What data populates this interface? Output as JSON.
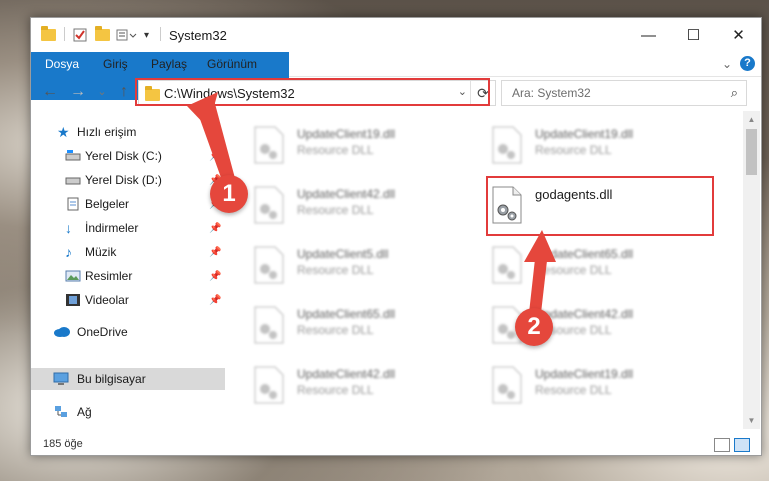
{
  "window": {
    "title": "System32",
    "minimize": "—",
    "maximize": "☐",
    "close": "✕"
  },
  "ribbon": {
    "tabs": [
      "Dosya",
      "Giriş",
      "Paylaş",
      "Görünüm"
    ],
    "collapse": "⌄",
    "help": "?"
  },
  "navigation": {
    "back": "←",
    "forward": "→",
    "recent": "⌄",
    "up": "↑",
    "address_path": "C:\\Windows\\System32",
    "address_dropdown": "⌄",
    "refresh": "⟳",
    "search_placeholder": "Ara: System32",
    "search_icon": "⌕"
  },
  "sidebar": {
    "items": [
      {
        "label": "Hızlı erişim",
        "icon": "star-icon"
      },
      {
        "label": "Yerel Disk (C:)",
        "icon": "drive-icon"
      },
      {
        "label": "Yerel Disk (D:)",
        "icon": "drive-icon"
      },
      {
        "label": "Belgeler",
        "icon": "documents-icon"
      },
      {
        "label": "İndirmeler",
        "icon": "download-icon"
      },
      {
        "label": "Müzik",
        "icon": "music-icon"
      },
      {
        "label": "Resimler",
        "icon": "pictures-icon"
      },
      {
        "label": "Videolar",
        "icon": "videos-icon"
      },
      {
        "label": "OneDrive",
        "icon": "cloud-icon"
      },
      {
        "label": "Bu bilgisayar",
        "icon": "computer-icon"
      },
      {
        "label": "Ağ",
        "icon": "network-icon"
      }
    ],
    "pin_glyph": "📌"
  },
  "files": [
    {
      "name": "UpdateClient19.dll",
      "type": "Resource DLL"
    },
    {
      "name": "UpdateClient19.dll",
      "type": "Resource DLL"
    },
    {
      "name": "UpdateClient42.dll",
      "type": "Resource DLL"
    },
    {
      "name": "godagents.dll",
      "type": ""
    },
    {
      "name": "UpdateClient5.dll",
      "type": "Resource DLL"
    },
    {
      "name": "UpdateClient65.dll",
      "type": "Resource DLL"
    },
    {
      "name": "UpdateClient65.dll",
      "type": "Resource DLL"
    },
    {
      "name": "UpdateClient42.dll",
      "type": "Resource DLL"
    },
    {
      "name": "UpdateClient42.dll",
      "type": "Resource DLL"
    },
    {
      "name": "UpdateClient19.dll",
      "type": "Resource DLL"
    }
  ],
  "status": {
    "item_count": "185 öğe"
  },
  "annotations": {
    "step1": "1",
    "step2": "2"
  },
  "colors": {
    "accent": "#1979ca",
    "annotation_red": "#e23b3b",
    "folder": "#f4c542"
  }
}
